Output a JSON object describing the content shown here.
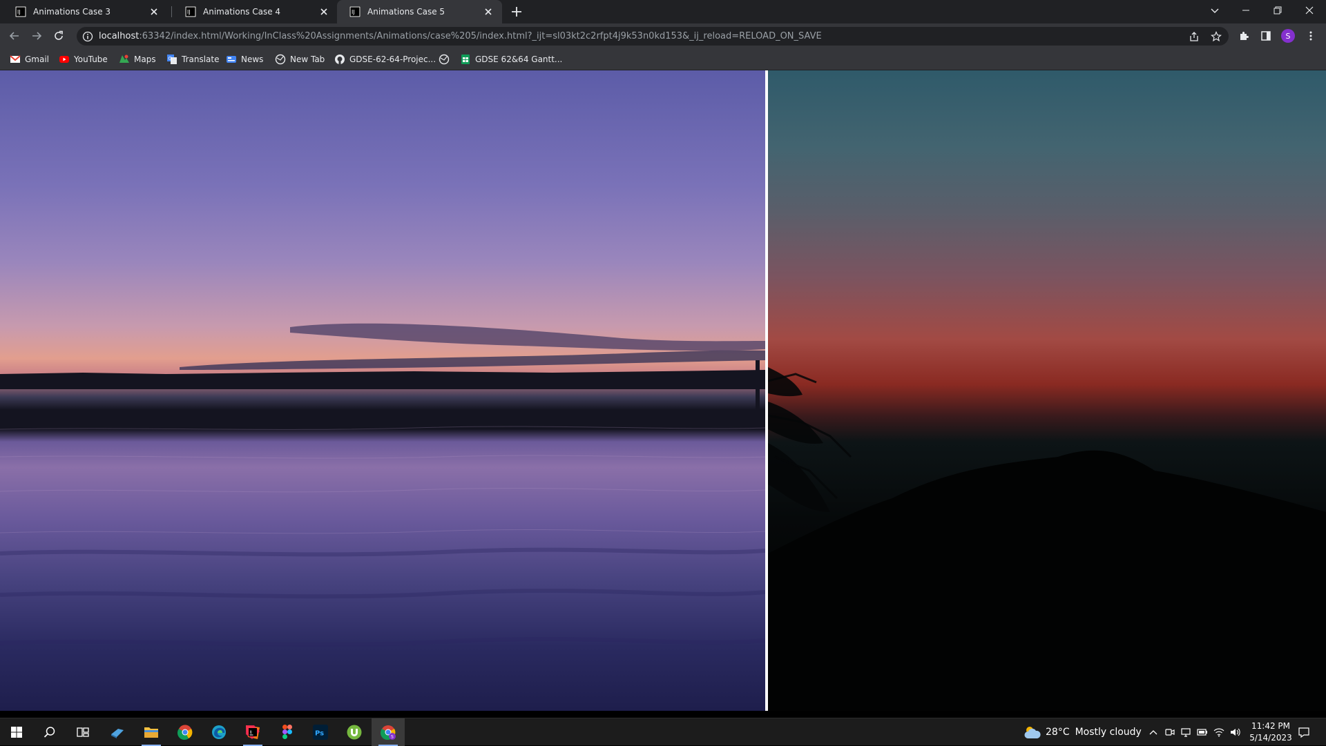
{
  "browser": {
    "tabs": [
      {
        "title": "Animations Case 3",
        "active": false
      },
      {
        "title": "Animations Case 4",
        "active": false
      },
      {
        "title": "Animations Case 5",
        "active": true
      }
    ],
    "address": {
      "host": "localhost",
      "path": ":63342/index.html/Working/InClass%20Assignments/Animations/case%205/index.html?_ijt=sl03kt2c2rfpt4j9k53n0kd153&_ij_reload=RELOAD_ON_SAVE"
    },
    "profile_initial": "S",
    "bookmarks": [
      {
        "label": "Gmail",
        "icon": "gmail-icon"
      },
      {
        "label": "YouTube",
        "icon": "youtube-icon"
      },
      {
        "label": "Maps",
        "icon": "maps-icon"
      },
      {
        "label": "Translate",
        "icon": "translate-icon"
      },
      {
        "label": "News",
        "icon": "news-icon"
      },
      {
        "label": "New Tab",
        "icon": "globe-icon"
      },
      {
        "label": "GDSE-62-64-Projec...",
        "icon": "github-icon"
      },
      {
        "label": "",
        "icon": "globe-icon"
      },
      {
        "label": "GDSE 62&64 Gantt...",
        "icon": "sheets-icon"
      }
    ]
  },
  "page": {
    "left_image": "sunset-over-lake-photo",
    "right_image": "dusk-tree-silhouette-photo"
  },
  "taskbar": {
    "apps": [
      "start-icon",
      "search-icon",
      "task-view-icon",
      "app-icon",
      "file-explorer-icon",
      "chrome-icon",
      "edge-icon",
      "intellij-icon",
      "figma-icon",
      "photoshop-icon",
      "utorrent-icon",
      "chrome-profile-icon"
    ],
    "weather": {
      "temp": "28°C",
      "condition": "Mostly cloudy"
    },
    "time": "11:42 PM",
    "date": "5/14/2023"
  },
  "colors": {
    "tabstrip": "#202124",
    "toolbar": "#35363a",
    "accent": "#8ab4f8"
  }
}
